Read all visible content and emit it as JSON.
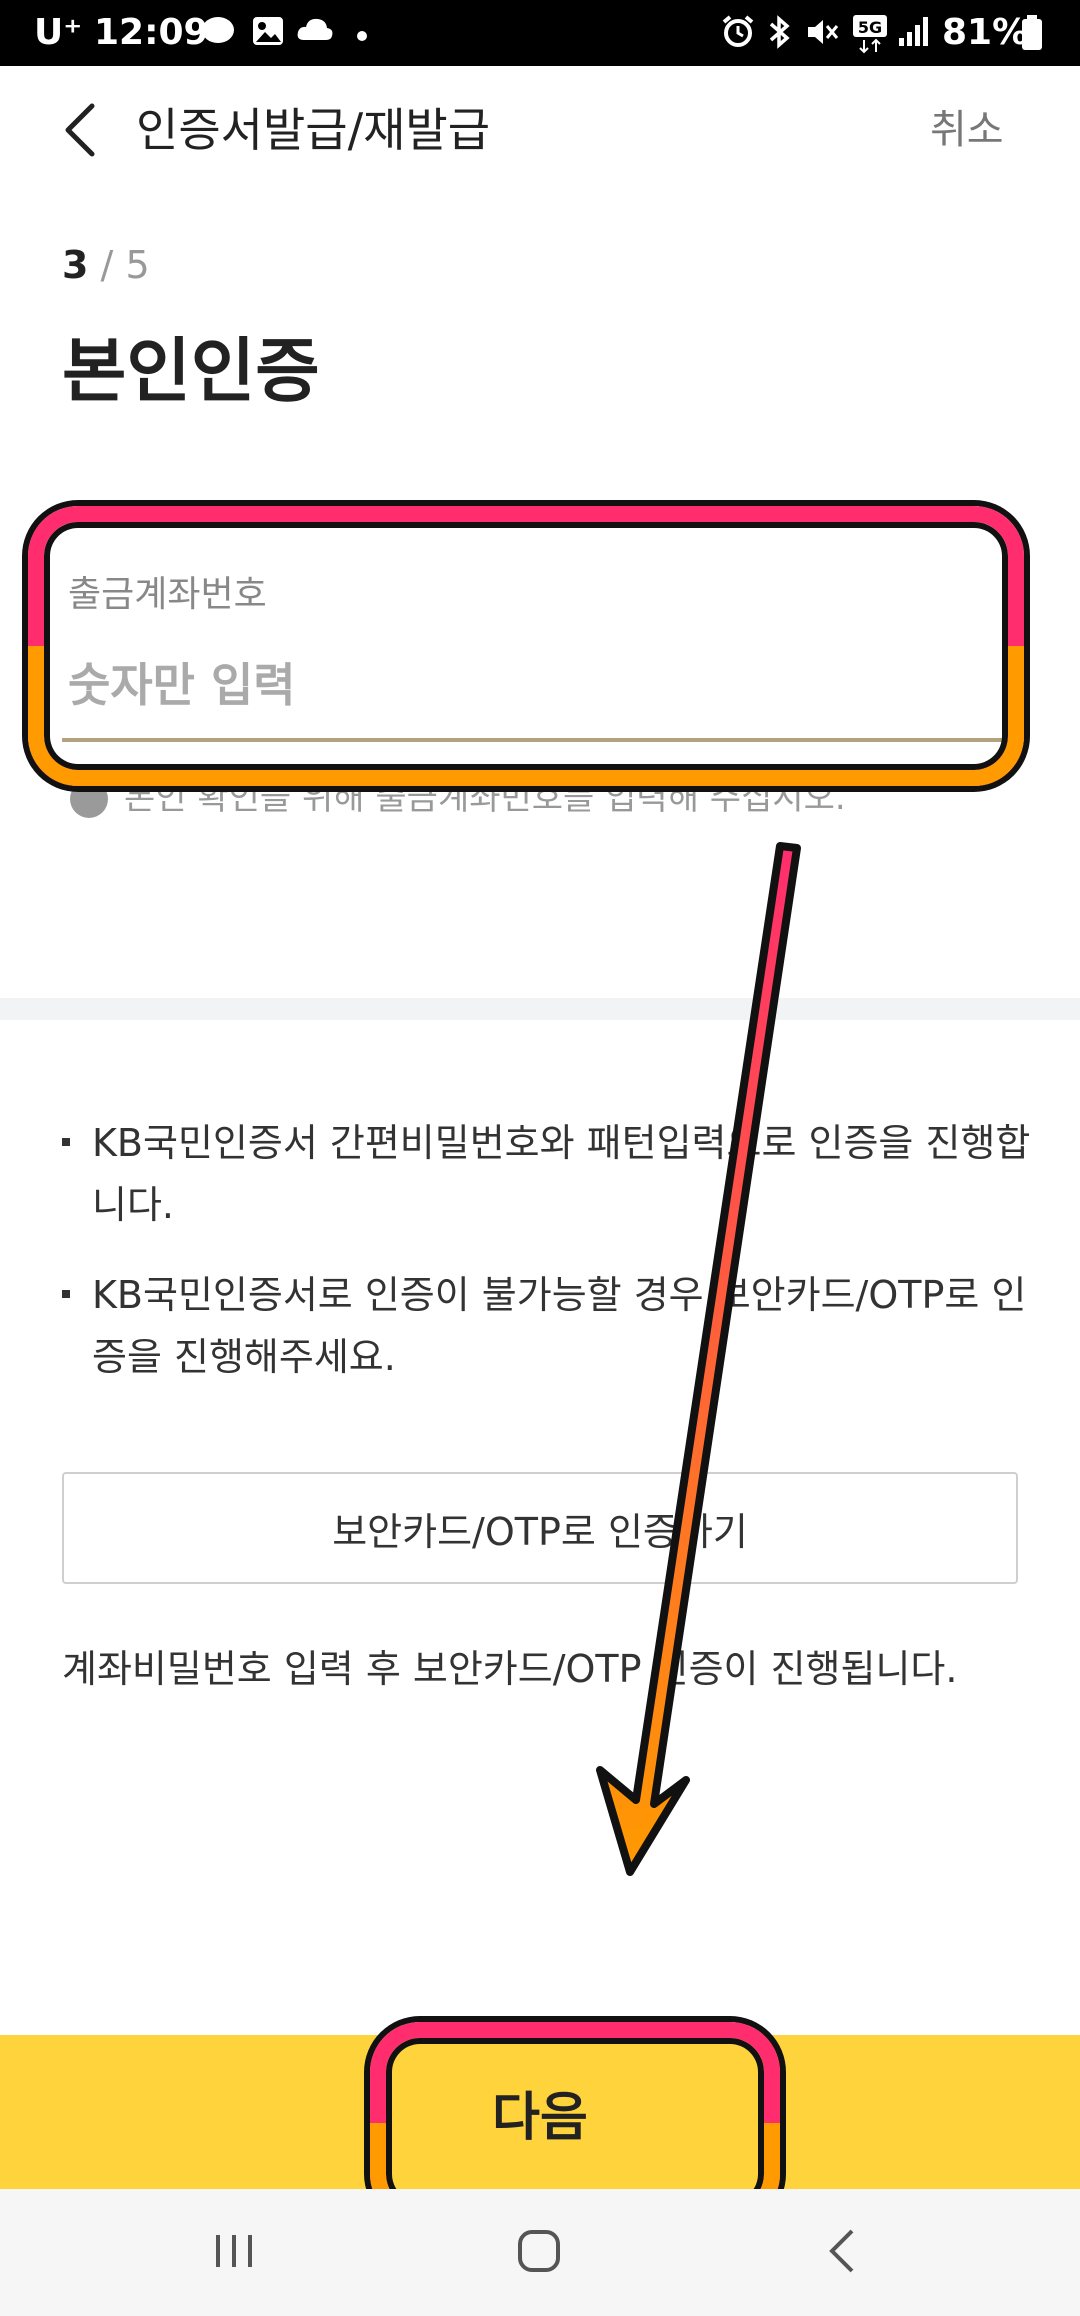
{
  "status_bar": {
    "carrier": "U⁺",
    "time": "12:09",
    "battery": "81%",
    "icons": [
      "talk-icon",
      "gallery-icon",
      "cloud-icon",
      "dot-icon",
      "alarm-icon",
      "bluetooth-icon",
      "mute-icon",
      "5g-icon",
      "signal-icon",
      "battery-icon"
    ]
  },
  "header": {
    "title": "인증서발급/재발급",
    "cancel_label": "취소"
  },
  "step": {
    "current": "3",
    "separator": "/",
    "total": "5"
  },
  "page_title": "본인인증",
  "account_field": {
    "label": "출금계좌번호",
    "placeholder": "숫자만 입력",
    "hint": "본인 확인을 위해 출금계좌번호를 입력해 주십시오."
  },
  "info_bullets": [
    "KB국민인증서 간편비밀번호와 패턴입력으로 인증을 진행합니다.",
    "KB국민인증서로 인증이 불가능할 경우 보안카드/OTP로 인증을 진행해주세요."
  ],
  "otp_button_label": "보안카드/OTP로 인증하기",
  "otp_note": "계좌비밀번호 입력 후 보안카드/OTP 인증이 진행됩니다.",
  "next_button_label": "다음",
  "colors": {
    "accent_yellow": "#ffd33b",
    "highlight_pink": "#ff2d6e",
    "highlight_orange": "#ff9a00",
    "underline": "#b4a27e"
  }
}
